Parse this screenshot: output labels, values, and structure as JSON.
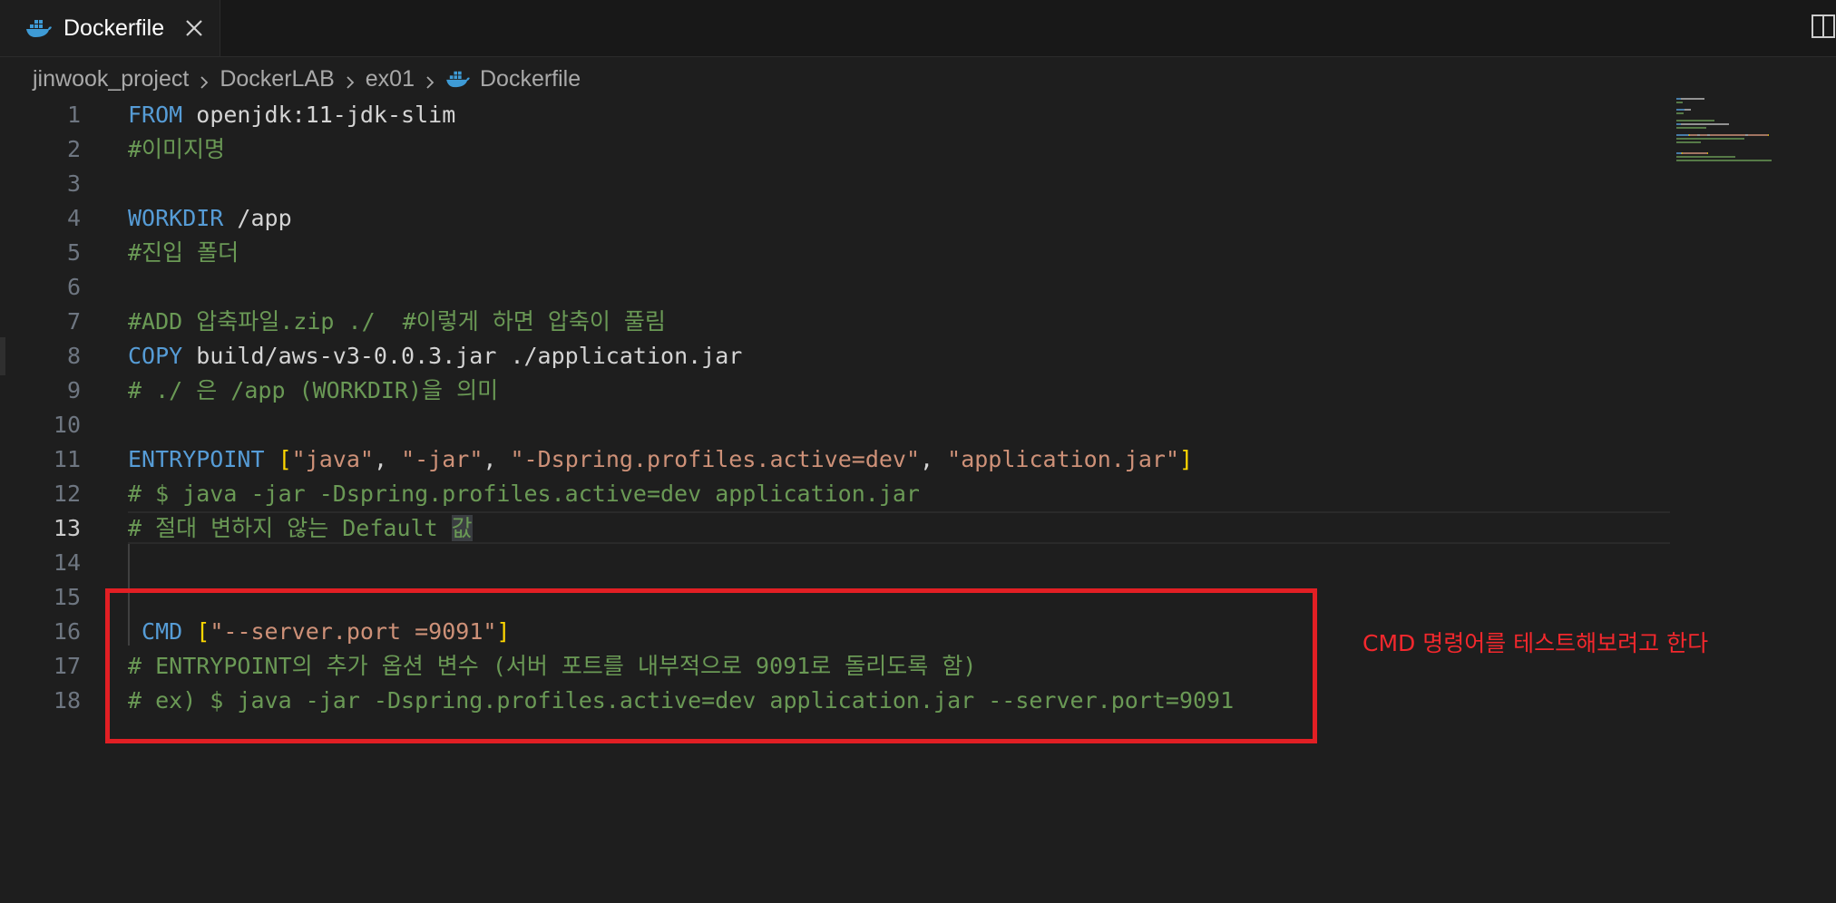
{
  "tab": {
    "title": "Dockerfile",
    "icon": "docker-icon",
    "close_icon": "close-icon"
  },
  "breadcrumb": {
    "items": [
      "jinwook_project",
      "DockerLAB",
      "ex01",
      "Dockerfile"
    ]
  },
  "editor": {
    "active_line": 13,
    "lines": [
      {
        "num": "1",
        "tokens": [
          {
            "t": "FROM",
            "c": "kw"
          },
          {
            "t": " openjdk:11-jdk-slim",
            "c": "plain"
          }
        ]
      },
      {
        "num": "2",
        "tokens": [
          {
            "t": "#이미지명",
            "c": "cm"
          }
        ]
      },
      {
        "num": "3",
        "tokens": []
      },
      {
        "num": "4",
        "tokens": [
          {
            "t": "WORKDIR",
            "c": "kw"
          },
          {
            "t": " /app",
            "c": "plain"
          }
        ]
      },
      {
        "num": "5",
        "tokens": [
          {
            "t": "#진입 폴더",
            "c": "cm"
          }
        ]
      },
      {
        "num": "6",
        "tokens": []
      },
      {
        "num": "7",
        "tokens": [
          {
            "t": "#ADD 압축파일.zip ./  #이렇게 하면 압축이 풀림",
            "c": "cm"
          }
        ]
      },
      {
        "num": "8",
        "tokens": [
          {
            "t": "COPY",
            "c": "kw"
          },
          {
            "t": " build/aws-v3-0.0.3.jar ./application.jar",
            "c": "plain"
          }
        ]
      },
      {
        "num": "9",
        "tokens": [
          {
            "t": "# ./ 은 /app (WORKDIR)을 의미",
            "c": "cm"
          }
        ]
      },
      {
        "num": "10",
        "tokens": []
      },
      {
        "num": "11",
        "tokens": [
          {
            "t": "ENTRYPOINT",
            "c": "kw"
          },
          {
            "t": " ",
            "c": "plain"
          },
          {
            "t": "[",
            "c": "br"
          },
          {
            "t": "\"java\"",
            "c": "str"
          },
          {
            "t": ", ",
            "c": "plain"
          },
          {
            "t": "\"-jar\"",
            "c": "str"
          },
          {
            "t": ", ",
            "c": "plain"
          },
          {
            "t": "\"-Dspring.profiles.active=dev\"",
            "c": "str"
          },
          {
            "t": ", ",
            "c": "plain"
          },
          {
            "t": "\"application.jar\"",
            "c": "str"
          },
          {
            "t": "]",
            "c": "br"
          }
        ]
      },
      {
        "num": "12",
        "tokens": [
          {
            "t": "# $ java -jar -Dspring.profiles.active=dev application.jar",
            "c": "cm"
          }
        ]
      },
      {
        "num": "13",
        "tokens": [
          {
            "t": "# 절대 변하지 않는 Default ",
            "c": "cm"
          },
          {
            "t": "값",
            "c": "cm-hl"
          }
        ]
      },
      {
        "num": "14",
        "tokens": []
      },
      {
        "num": "15",
        "tokens": []
      },
      {
        "num": "16",
        "tokens": [
          {
            "t": " CMD",
            "c": "kw"
          },
          {
            "t": " ",
            "c": "plain"
          },
          {
            "t": "[",
            "c": "br"
          },
          {
            "t": "\"--server.port =9091\"",
            "c": "str"
          },
          {
            "t": "]",
            "c": "br"
          }
        ]
      },
      {
        "num": "17",
        "tokens": [
          {
            "t": "# ENTRYPOINT의 추가 옵션 변수 (서버 포트를 내부적으로 9091로 돌리도록 함)",
            "c": "cm"
          }
        ]
      },
      {
        "num": "18",
        "tokens": [
          {
            "t": "# ex) $ java -jar -Dspring.profiles.active=dev application.jar --server.port=9091",
            "c": "cm"
          }
        ]
      }
    ]
  },
  "annotation": {
    "text": "CMD 명령어를 테스트해보려고 한다"
  },
  "colors": {
    "keyword": "#569cd6",
    "string": "#ce9178",
    "comment": "#6a9955",
    "bracket": "#ffd700",
    "highlight_box": "#e21f24"
  }
}
